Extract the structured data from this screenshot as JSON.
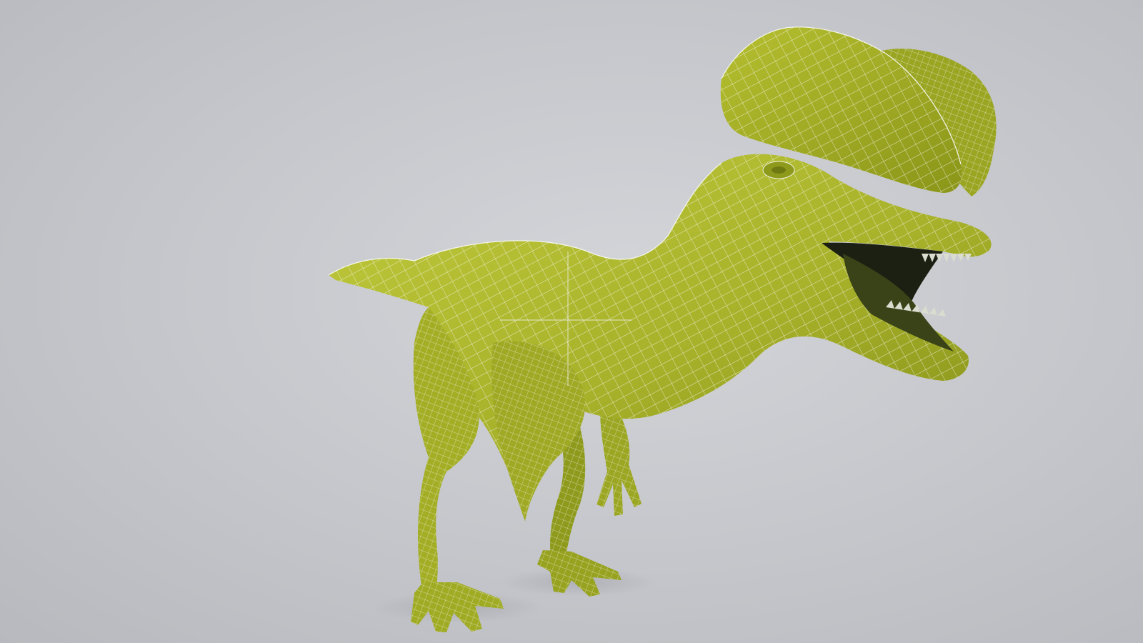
{
  "viewport": {
    "background": "#c6c8cc"
  },
  "model": {
    "subject": "dinosaur-mesh",
    "display_mode": "wireframe-on-shaded",
    "colors": {
      "skin": "#a8b22a",
      "skin_dark": "#7f8a16",
      "skin_light": "#c2cb3c",
      "wire": "#ecefe0",
      "mouth": "#1c2012",
      "teeth": "#d9dccf"
    }
  }
}
